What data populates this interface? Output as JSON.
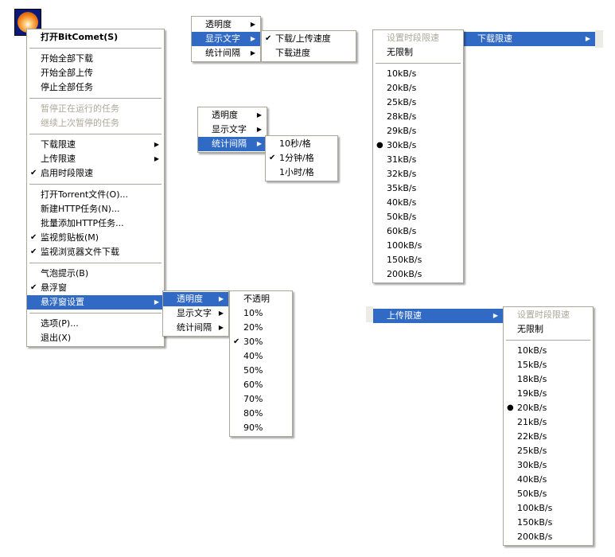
{
  "icon": "bitcomet-tray-icon",
  "colors": {
    "highlight": "#316ac5",
    "border": "#aca899",
    "disabled": "#aca899"
  },
  "menus": [
    {
      "id": "main",
      "items": [
        {
          "label": "打开BitComet(S)",
          "bold": true
        },
        {
          "sep": true
        },
        {
          "label": "开始全部下载"
        },
        {
          "label": "开始全部上传"
        },
        {
          "label": "停止全部任务"
        },
        {
          "sep": true
        },
        {
          "label": "暂停正在运行的任务",
          "disabled": true
        },
        {
          "label": "继续上次暂停的任务",
          "disabled": true
        },
        {
          "sep": true
        },
        {
          "label": "下载限速",
          "submenu": true
        },
        {
          "label": "上传限速",
          "submenu": true
        },
        {
          "label": "启用时段限速",
          "checked": true
        },
        {
          "sep": true
        },
        {
          "label": "打开Torrent文件(O)..."
        },
        {
          "label": "新建HTTP任务(N)..."
        },
        {
          "label": "批量添加HTTP任务..."
        },
        {
          "label": "监视剪贴板(M)",
          "checked": true
        },
        {
          "label": "监视浏览器文件下载",
          "checked": true
        },
        {
          "sep": true
        },
        {
          "label": "气泡提示(B)"
        },
        {
          "label": "悬浮窗",
          "checked": true
        },
        {
          "label": "悬浮窗设置",
          "submenu": true,
          "highlighted": true
        },
        {
          "sep": true
        },
        {
          "label": "选项(P)..."
        },
        {
          "label": "退出(X)"
        }
      ]
    },
    {
      "id": "float-settings-a",
      "items": [
        {
          "label": "透明度",
          "submenu": true,
          "highlighted": true
        },
        {
          "label": "显示文字",
          "submenu": true
        },
        {
          "label": "统计间隔",
          "submenu": true
        }
      ]
    },
    {
      "id": "opacity",
      "items": [
        {
          "label": "不透明"
        },
        {
          "label": "10%"
        },
        {
          "label": "20%"
        },
        {
          "label": "30%",
          "checked": true
        },
        {
          "label": "40%"
        },
        {
          "label": "50%"
        },
        {
          "label": "60%"
        },
        {
          "label": "70%"
        },
        {
          "label": "80%"
        },
        {
          "label": "90%"
        }
      ]
    },
    {
      "id": "float-settings-b",
      "items": [
        {
          "label": "透明度",
          "submenu": true
        },
        {
          "label": "显示文字",
          "submenu": true,
          "highlighted": true
        },
        {
          "label": "统计间隔",
          "submenu": true
        }
      ]
    },
    {
      "id": "display-text",
      "items": [
        {
          "label": "下载/上传速度",
          "checked": true
        },
        {
          "label": "下载进度"
        }
      ]
    },
    {
      "id": "float-settings-c",
      "items": [
        {
          "label": "透明度",
          "submenu": true
        },
        {
          "label": "显示文字",
          "submenu": true
        },
        {
          "label": "统计间隔",
          "submenu": true,
          "highlighted": true
        }
      ]
    },
    {
      "id": "interval",
      "items": [
        {
          "label": "10秒/格"
        },
        {
          "label": "1分钟/格",
          "checked": true
        },
        {
          "label": "1小时/格"
        }
      ]
    },
    {
      "id": "download-limit",
      "items": [
        {
          "label": "设置时段限速",
          "disabled": true
        },
        {
          "label": "无限制"
        },
        {
          "sep": true
        },
        {
          "label": "10kB/s"
        },
        {
          "label": "20kB/s"
        },
        {
          "label": "25kB/s"
        },
        {
          "label": "28kB/s"
        },
        {
          "label": "29kB/s"
        },
        {
          "label": "30kB/s",
          "radio": true
        },
        {
          "label": "31kB/s"
        },
        {
          "label": "32kB/s"
        },
        {
          "label": "35kB/s"
        },
        {
          "label": "40kB/s"
        },
        {
          "label": "50kB/s"
        },
        {
          "label": "60kB/s"
        },
        {
          "label": "100kB/s"
        },
        {
          "label": "150kB/s"
        },
        {
          "label": "200kB/s"
        }
      ]
    },
    {
      "id": "upload-limit",
      "items": [
        {
          "label": "设置时段限速",
          "disabled": true
        },
        {
          "label": "无限制"
        },
        {
          "sep": true
        },
        {
          "label": "10kB/s"
        },
        {
          "label": "15kB/s"
        },
        {
          "label": "18kB/s"
        },
        {
          "label": "19kB/s"
        },
        {
          "label": "20kB/s",
          "radio": true
        },
        {
          "label": "21kB/s"
        },
        {
          "label": "22kB/s"
        },
        {
          "label": "25kB/s"
        },
        {
          "label": "30kB/s"
        },
        {
          "label": "40kB/s"
        },
        {
          "label": "50kB/s"
        },
        {
          "label": "100kB/s"
        },
        {
          "label": "150kB/s"
        },
        {
          "label": "200kB/s"
        }
      ]
    }
  ],
  "strips": {
    "download": "下载限速",
    "upload": "上传限速"
  }
}
